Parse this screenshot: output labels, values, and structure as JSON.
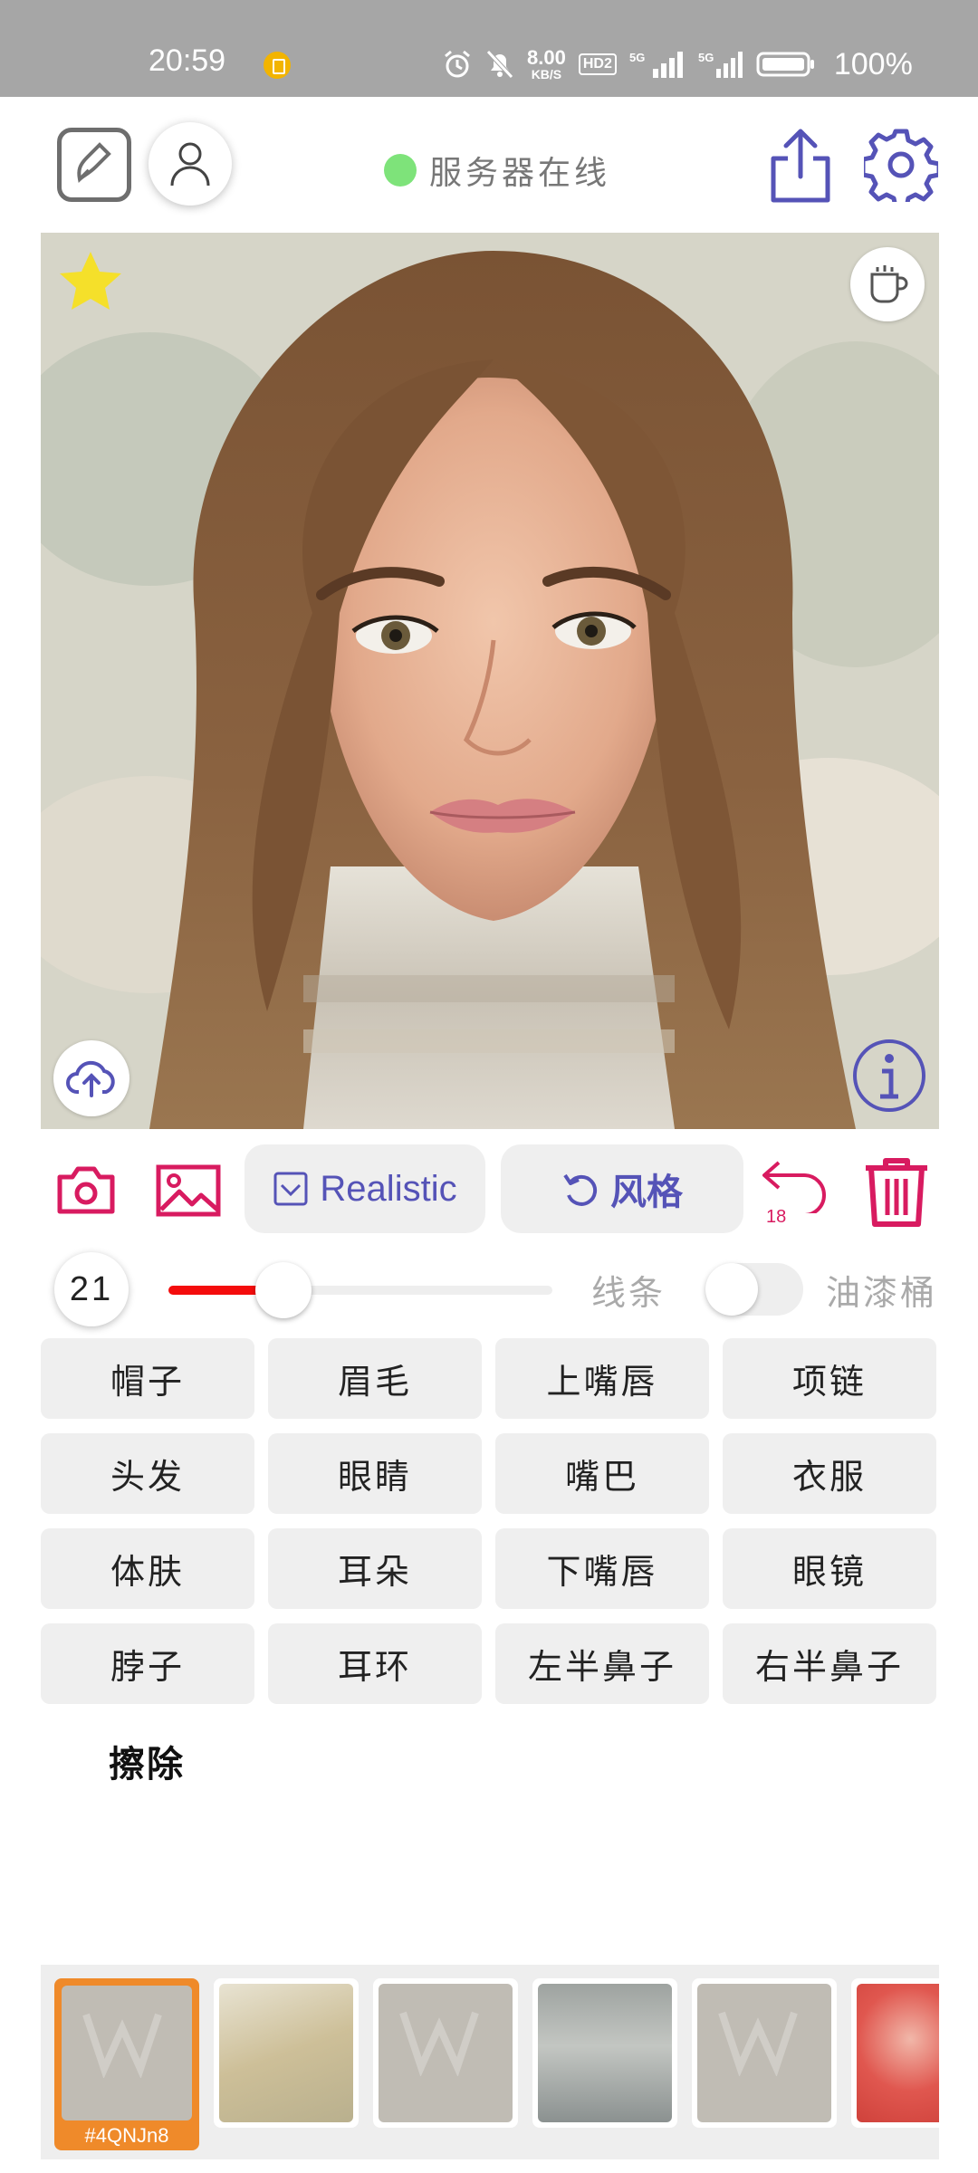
{
  "status_bar": {
    "time": "20:59",
    "net_speed_value": "8.00",
    "net_speed_unit": "KB/S",
    "hd_label": "HD2",
    "sig1_label": "5G",
    "sig2_label": "5G",
    "battery": "100%"
  },
  "header": {
    "server_status": "服务器在线",
    "status_color": "#7ee37a"
  },
  "canvas": {
    "favorite_color": "#f5e02a",
    "info_color": "#5553b7"
  },
  "actions": {
    "model_label": "Realistic",
    "style_label": "风格",
    "undo_count": "18",
    "accent_color": "#d81b60"
  },
  "brush": {
    "size": "21",
    "slider_fraction": 0.3,
    "mode_line": "线条",
    "mode_bucket": "油漆桶",
    "bucket_enabled": false
  },
  "parts": [
    "帽子",
    "眉毛",
    "上嘴唇",
    "项链",
    "头发",
    "眼睛",
    "嘴巴",
    "衣服",
    "体肤",
    "耳朵",
    "下嘴唇",
    "眼镜",
    "脖子",
    "耳环",
    "左半鼻子",
    "右半鼻子"
  ],
  "erase_label": "擦除",
  "thumbnails": {
    "active_label": "#4QNJn8",
    "active_color": "#ef8a2a"
  }
}
